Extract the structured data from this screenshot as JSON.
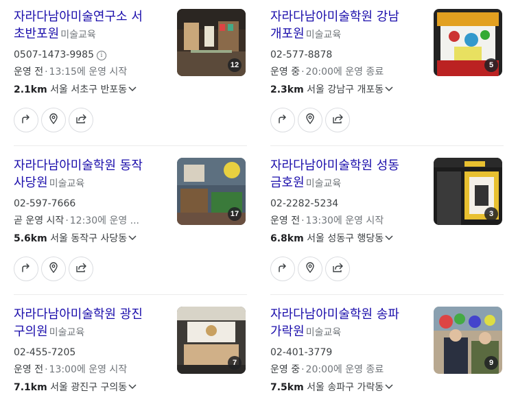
{
  "listings": [
    {
      "name": "자라다남아미술연구소 서초반포원",
      "name_lines": [
        "자라다남아미술연구소 서",
        "초반포원"
      ],
      "category": "미술교육",
      "phone": "0507-1473-9985",
      "phone_info_icon": "info-icon",
      "status": "운영 전",
      "hours": "13:15에 운영 시작",
      "distance": "2.1km",
      "address": "서울 서초구 반포동",
      "photo_count": "12"
    },
    {
      "name": "자라다남아미술학원 강남개포원",
      "name_lines": [
        "자라다남아미술학원 강남",
        "개포원"
      ],
      "category": "미술교육",
      "phone": "02-577-8878",
      "status": "운영 중",
      "hours": "20:00에 운영 종료",
      "distance": "2.3km",
      "address": "서울 강남구 개포동",
      "photo_count": "5"
    },
    {
      "name": "자라다남아미술학원 동작사당원",
      "name_lines": [
        "자라다남아미술학원 동작",
        "사당원"
      ],
      "category": "미술교육",
      "phone": "02-597-7666",
      "status": "곧 운영 시작",
      "hours": "12:30에 운영 ...",
      "distance": "5.6km",
      "address": "서울 동작구 사당동",
      "photo_count": "17"
    },
    {
      "name": "자라다남아미술학원 성동금호원",
      "name_lines": [
        "자라다남아미술학원 성동",
        "금호원"
      ],
      "category": "미술교육",
      "phone": "02-2282-5234",
      "status": "운영 전",
      "hours": "13:30에 운영 시작",
      "distance": "6.8km",
      "address": "서울 성동구 행당동",
      "photo_count": "3"
    },
    {
      "name": "자라다남아미술학원 광진구의원",
      "name_lines": [
        "자라다남아미술학원 광진",
        "구의원"
      ],
      "category": "미술교육",
      "phone": "02-455-7205",
      "status": "운영 전",
      "hours": "13:00에 운영 시작",
      "distance": "7.1km",
      "address": "서울 광진구 구의동",
      "photo_count": "7"
    },
    {
      "name": "자라다남아미술학원 송파가락원",
      "name_lines": [
        "자라다남아미술학원 송파",
        "가락원"
      ],
      "category": "미술교육",
      "phone": "02-401-3779",
      "status": "운영 중",
      "hours": "20:00에 운영 종료",
      "distance": "7.5km",
      "address": "서울 송파구 가락동",
      "photo_count": "9"
    }
  ],
  "icons": {
    "directions": "directions-icon",
    "map_pin": "map-pin-icon",
    "share": "share-icon",
    "expand": "chevron-down-icon"
  },
  "colors": {
    "link": "#1a0dab",
    "muted": "#70757a",
    "border": "#dadce0"
  }
}
